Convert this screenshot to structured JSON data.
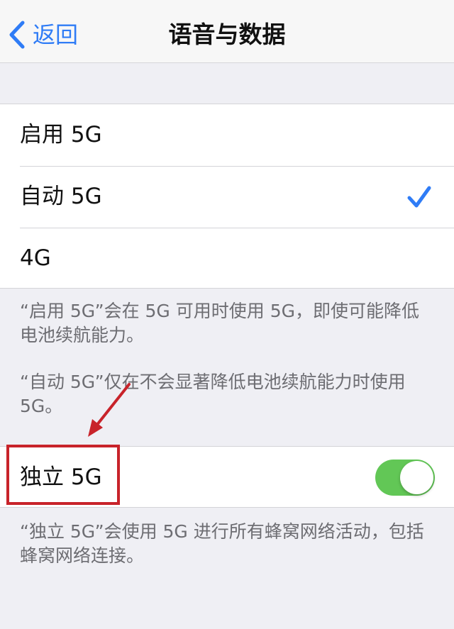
{
  "nav": {
    "back_label": "返回",
    "title": "语音与数据"
  },
  "network_options": [
    {
      "label": "启用 5G",
      "selected": false
    },
    {
      "label": "自动 5G",
      "selected": true
    },
    {
      "label": "4G",
      "selected": false
    }
  ],
  "footnotes": {
    "enable_5g": "“启用 5G”会在 5G 可用时使用 5G，即使可能降低电池续航能力。",
    "auto_5g": "“自动 5G”仅在不会显著降低电池续航能力时使用 5G。",
    "standalone_5g": "“独立 5G”会使用 5G 进行所有蜂窝网络活动，包括蜂窝网络连接。"
  },
  "standalone": {
    "label": "独立 5G",
    "enabled": true
  },
  "colors": {
    "accent": "#2f7cf6",
    "toggle_on": "#62c756",
    "annotation": "#c8232a",
    "background": "#efeff4"
  },
  "icons": {
    "back": "chevron-left-icon",
    "selected": "checkmark-icon"
  }
}
